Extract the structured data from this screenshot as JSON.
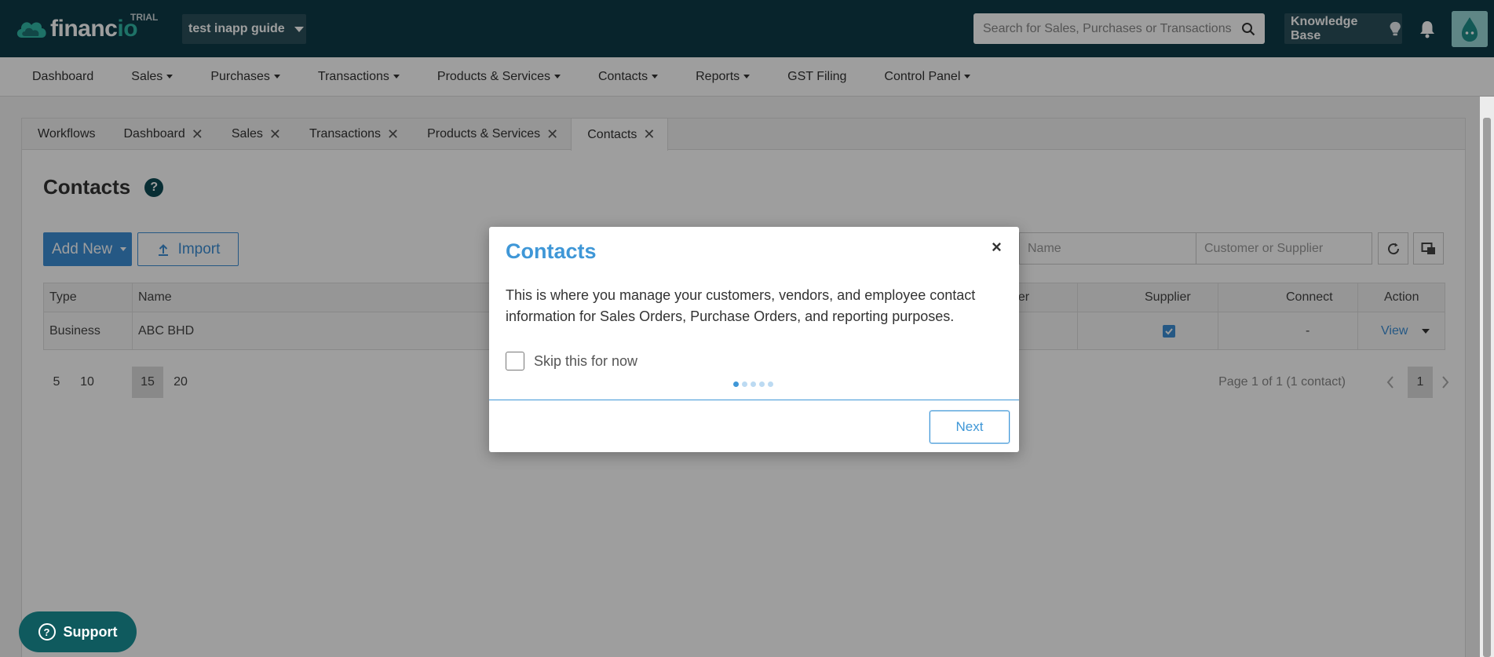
{
  "header": {
    "brand_name": "financio",
    "brand_main": "financ",
    "brand_accent": "io",
    "trial_badge": "TRIAL",
    "company": "test inapp guide",
    "search_placeholder": "Search for Sales, Purchases or Transactions",
    "knowledge_base": "Knowledge Base"
  },
  "nav": {
    "items": [
      {
        "label": "Dashboard",
        "dropdown": false
      },
      {
        "label": "Sales",
        "dropdown": true
      },
      {
        "label": "Purchases",
        "dropdown": true
      },
      {
        "label": "Transactions",
        "dropdown": true
      },
      {
        "label": "Products & Services",
        "dropdown": true
      },
      {
        "label": "Contacts",
        "dropdown": true
      },
      {
        "label": "Reports",
        "dropdown": true
      },
      {
        "label": "GST Filing",
        "dropdown": false
      },
      {
        "label": "Control Panel",
        "dropdown": true
      }
    ]
  },
  "tabs": [
    {
      "label": "Workflows",
      "closable": false
    },
    {
      "label": "Dashboard",
      "closable": true
    },
    {
      "label": "Sales",
      "closable": true
    },
    {
      "label": "Transactions",
      "closable": true
    },
    {
      "label": "Products & Services",
      "closable": true
    },
    {
      "label": "Contacts",
      "closable": true,
      "active": true
    }
  ],
  "page": {
    "title": "Contacts",
    "help_glyph": "?",
    "add_new": "Add New",
    "import": "Import",
    "filter_name_placeholder": "Name",
    "filter_type_placeholder": "Customer or Supplier"
  },
  "table": {
    "headers": {
      "type": "Type",
      "name": "Name",
      "customer_partial": "ner",
      "supplier": "Supplier",
      "connect": "Connect",
      "action": "Action"
    },
    "rows": [
      {
        "type": "Business",
        "name": "ABC BHD",
        "supplier": true,
        "connect": "-",
        "action": "View"
      }
    ]
  },
  "pagination": {
    "sizes": [
      "5",
      "10",
      "15",
      "20"
    ],
    "selected_size": "15",
    "info": "Page 1 of 1 (1 contact)",
    "current_page": "1"
  },
  "support": {
    "label": "Support"
  },
  "modal": {
    "title": "Contacts",
    "close_glyph": "×",
    "body": "This is where you manage your customers, vendors, and employee contact information for Sales Orders, Purchase Orders, and reporting purposes.",
    "skip_label": "Skip this for now",
    "step_current": 1,
    "step_total": 5,
    "next_label": "Next"
  },
  "colors": {
    "topbar": "#0e3a48",
    "accent": "#3f97d7",
    "brand_teal": "#31b8a6",
    "support_bg": "#0f5a5e"
  }
}
